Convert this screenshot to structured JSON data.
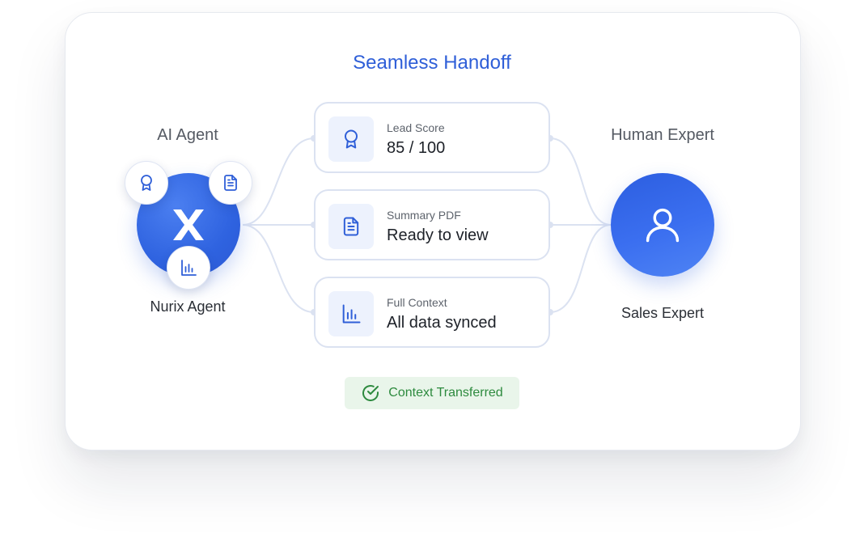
{
  "title": "Seamless Handoff",
  "agent": {
    "heading": "AI Agent",
    "name": "Nurix Agent",
    "icon": "nurix-x-logo",
    "badges": [
      "award-icon",
      "document-icon",
      "bar-chart-icon"
    ]
  },
  "expert": {
    "heading": "Human Expert",
    "name": "Sales Expert",
    "icon": "user-icon"
  },
  "cards": [
    {
      "label": "Lead Score",
      "value": "85 / 100",
      "icon": "award-icon"
    },
    {
      "label": "Summary PDF",
      "value": "Ready to view",
      "icon": "document-icon"
    },
    {
      "label": "Full Context",
      "value": "All data synced",
      "icon": "bar-chart-icon"
    }
  ],
  "status": {
    "label": "Context Transferred",
    "icon": "check-circle-icon"
  },
  "colors": {
    "accent": "#2f5fd8",
    "success": "#2d8a3e",
    "success_bg": "#e9f5ea",
    "connector": "#dbe2f1"
  }
}
